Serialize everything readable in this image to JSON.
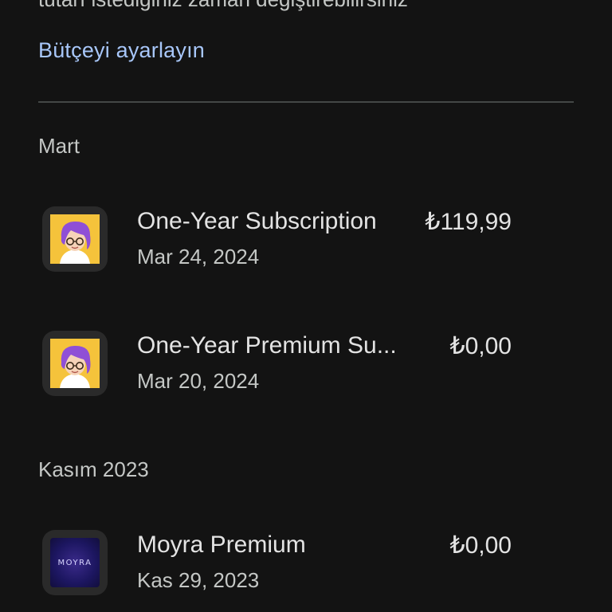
{
  "budget": {
    "description_fragment": "tutarı istediğiniz zaman değiştirebilirsiniz",
    "link_label": "Bütçeyi ayarlayın"
  },
  "sections": [
    {
      "header": "Mart",
      "items": [
        {
          "title": "One-Year Subscription",
          "date": "Mar 24, 2024",
          "price": "₺119,99",
          "icon": "avatar-app-icon"
        },
        {
          "title": "One-Year Premium Su...",
          "date": "Mar 20, 2024",
          "price": "₺0,00",
          "icon": "avatar-app-icon"
        }
      ]
    },
    {
      "header": "Kasım 2023",
      "items": [
        {
          "title": "Moyra Premium",
          "date": "Kas 29, 2023",
          "price": "₺0,00",
          "icon": "moyra-app-icon",
          "icon_text": "MOYRA"
        }
      ]
    }
  ],
  "colors": {
    "background": "#131313",
    "link": "#a8c7fa",
    "primary_text": "#e3e3e3",
    "secondary_text": "#c4c7c5",
    "divider": "#444746",
    "avatar_icon_bg": "#f5c33b",
    "avatar_hair": "#8f4fd6"
  }
}
